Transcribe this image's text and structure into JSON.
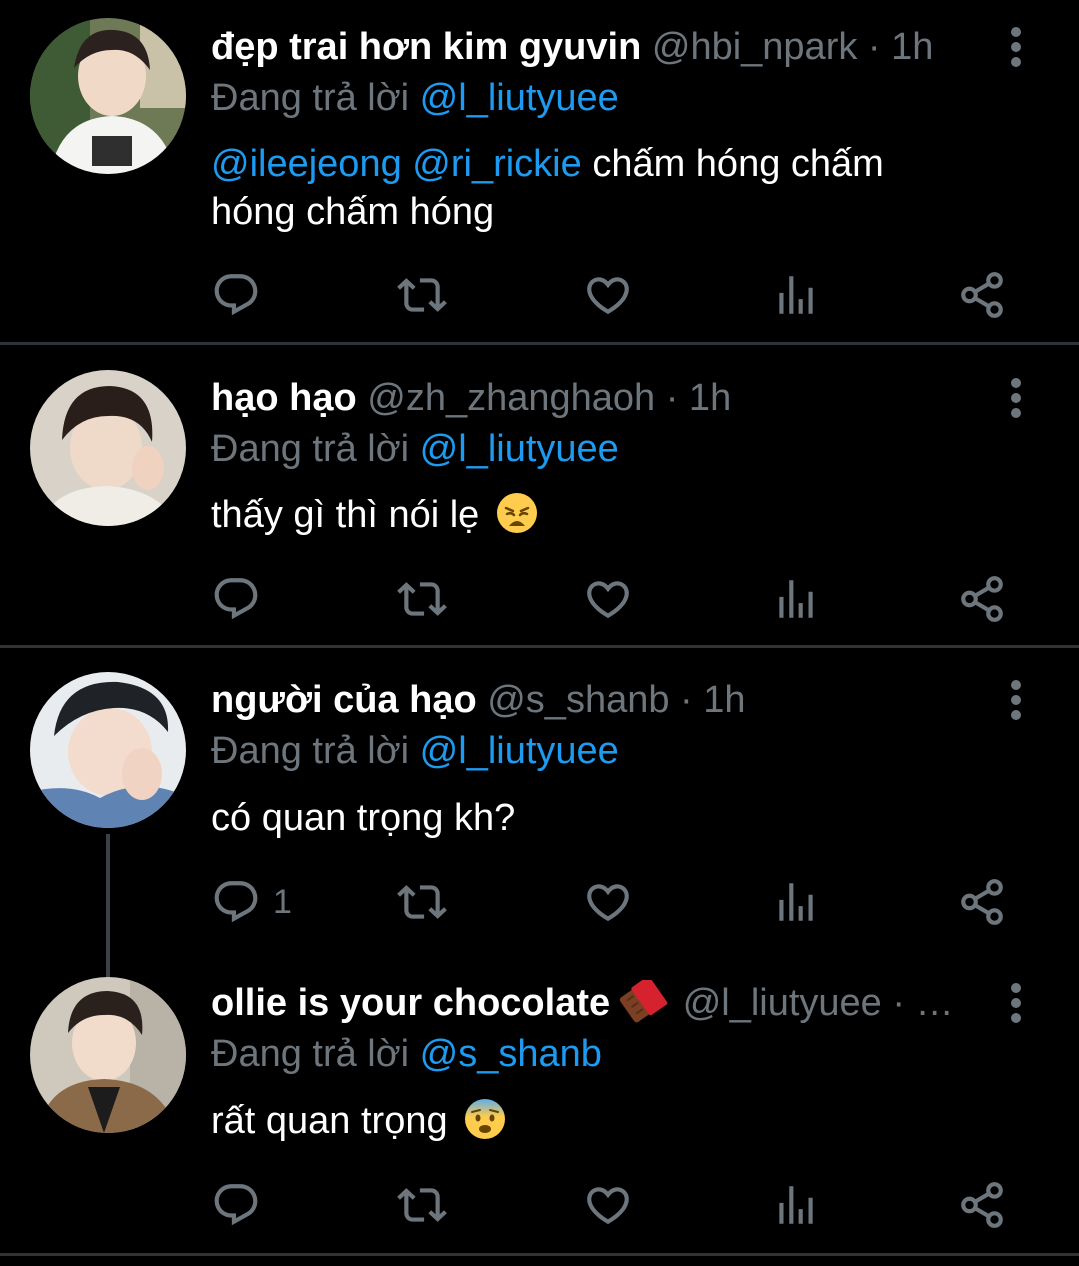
{
  "tweets": [
    {
      "display_name": "đẹp trai hơn kim gyuvin",
      "handle_meta": "@hbi_npark · 1h",
      "reply_prefix": "Đang trả lời",
      "reply_to": "@l_liutyuee",
      "mention_1": "@ileejeong",
      "mention_2": "@ri_rickie",
      "text": " chấm hóng chấm hóng chấm hóng",
      "reply_count": ""
    },
    {
      "display_name": "hạo hạo",
      "handle_meta": "@zh_zhanghaoh · 1h",
      "reply_prefix": "Đang trả lời",
      "reply_to": "@l_liutyuee",
      "text": "thấy gì thì nói lẹ",
      "emoji": "weary-face",
      "reply_count": ""
    },
    {
      "display_name": "người của hạo",
      "handle_meta": "@s_shanb · 1h",
      "reply_prefix": "Đang trả lời",
      "reply_to": "@l_liutyuee",
      "text": "có quan trọng kh?",
      "reply_count": "1"
    },
    {
      "display_name": "ollie is your chocolate",
      "name_emoji": "chocolate-bar",
      "handle_meta": "@l_liutyuee · …",
      "reply_prefix": "Đang trả lời",
      "reply_to": "@s_shanb",
      "text": "rất quan trọng",
      "emoji": "anxious-face",
      "reply_count": ""
    }
  ],
  "icons": [
    "reply-icon",
    "retweet-icon",
    "like-icon",
    "views-icon",
    "share-icon",
    "more-icon"
  ],
  "colors": {
    "background": "#000000",
    "text": "#ffffff",
    "muted": "#6e767d",
    "link": "#1d9bf0",
    "divider": "#2f3336"
  }
}
